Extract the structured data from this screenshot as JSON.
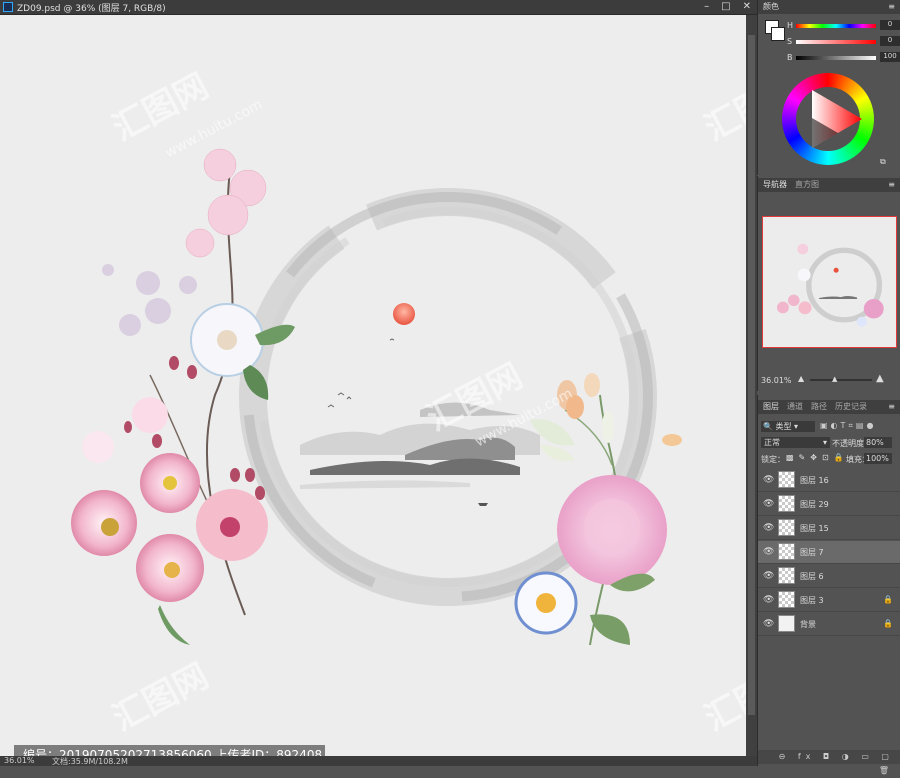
{
  "window": {
    "title": "ZD09.psd @ 36% (图层 7, RGB/8)",
    "minimize": "–",
    "maximize": "□",
    "close": "✕"
  },
  "canvas": {
    "watermark_text": "汇图网",
    "watermark_url": "www.huitu.com",
    "caption": "编号：20190705202713856060 上传者ID：892408"
  },
  "status": {
    "zoom": "36.01%",
    "doc": "文档:35.9M/108.2M"
  },
  "color_panel": {
    "tab": "颜色",
    "h_label": "H",
    "h_value": "0",
    "h_unit": "°",
    "s_label": "S",
    "s_value": "0",
    "s_unit": "%",
    "b_label": "B",
    "b_value": "100",
    "b_unit": "%"
  },
  "navigator": {
    "tab_navigator": "导航器",
    "tab_histogram": "直方图",
    "zoom": "36.01%"
  },
  "layers_panel": {
    "tabs": [
      "图层",
      "通道",
      "路径",
      "历史记录"
    ],
    "filter_kind": "类型",
    "blend_mode": "正常",
    "opacity_label": "不透明度：",
    "opacity_value": "80%",
    "lock_label": "锁定：",
    "fill_label": "填充：",
    "fill_value": "100%",
    "layers": [
      {
        "name": "图层 16",
        "selected": false,
        "locked": false
      },
      {
        "name": "图层 29",
        "selected": false,
        "locked": false
      },
      {
        "name": "图层 15",
        "selected": false,
        "locked": false
      },
      {
        "name": "图层 7",
        "selected": true,
        "locked": false
      },
      {
        "name": "图层 6",
        "selected": false,
        "locked": false
      },
      {
        "name": "图层 3",
        "selected": false,
        "locked": true
      },
      {
        "name": "背景",
        "selected": false,
        "locked": true
      }
    ]
  },
  "colors": {
    "ui_bg": "#535353",
    "canvas_bg": "#ededed",
    "selected_layer": "#6a6a6a",
    "nav_frame": "#e03a3a"
  }
}
